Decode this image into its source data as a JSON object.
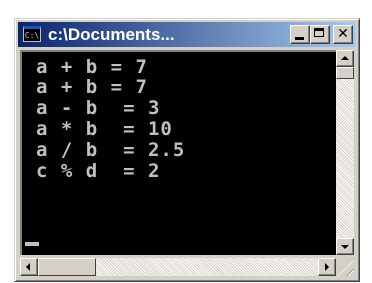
{
  "window": {
    "title": "c:\\Documents...",
    "icon": "cmd-icon",
    "controls": [
      "minimize-icon",
      "maximize-icon",
      "close-icon"
    ],
    "close_glyph": "✕",
    "icon_text": "C:\\"
  },
  "console": {
    "lines": [
      "a + b = 7",
      "a + b = 7",
      "a - b  = 3",
      "a * b  = 10",
      "a / b  = 2.5",
      "c % d  = 2"
    ],
    "text_color": "#c0c0c0",
    "background_color": "#000000"
  },
  "colors": {
    "titlebar_start": "#0a246a",
    "titlebar_end": "#a6caf0",
    "chrome": "#d4d0c8"
  }
}
